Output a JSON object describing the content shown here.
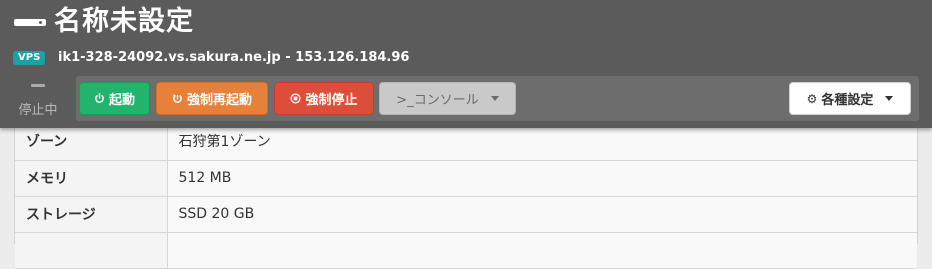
{
  "header": {
    "title": "名称未設定",
    "badge": "VPS",
    "hostline": "ik1-328-24092.vs.sakura.ne.jp - 153.126.184.96"
  },
  "status": {
    "label": "停止中"
  },
  "toolbar": {
    "start_label": "起動",
    "force_reboot_label": "強制再起動",
    "force_stop_label": "強制停止",
    "console_label": ">_コンソール",
    "settings_label": "各種設定"
  },
  "specs": [
    {
      "label": "ゾーン",
      "value": "石狩第1ゾーン"
    },
    {
      "label": "メモリ",
      "value": "512 MB"
    },
    {
      "label": "ストレージ",
      "value": "SSD 20 GB"
    }
  ],
  "colors": {
    "header_bg": "#5b5b5b",
    "start": "#21b46c",
    "reboot": "#e7813a",
    "stop": "#dc4d3a",
    "badge": "#17a2a4"
  }
}
